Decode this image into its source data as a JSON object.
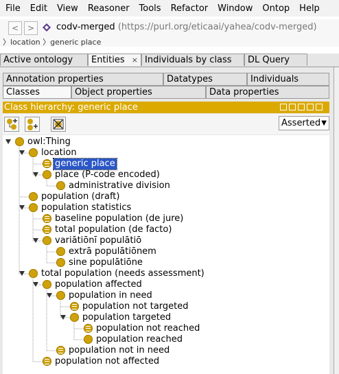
{
  "menu": [
    "File",
    "Edit",
    "View",
    "Reasoner",
    "Tools",
    "Refactor",
    "Window",
    "Ontop",
    "Help"
  ],
  "address": {
    "back_label": "<",
    "forward_label": ">",
    "ontology_name": "codv-merged",
    "ontology_url": "(https://purl.org/eticaai/yahea/codv-merged)",
    "breadcrumb": "〉location 〉generic place"
  },
  "main_tabs": [
    {
      "label": "Active ontology",
      "active": false
    },
    {
      "label": "Entities",
      "active": true
    },
    {
      "label": "Individuals by class",
      "active": false
    },
    {
      "label": "DL Query",
      "active": false
    }
  ],
  "close_glyph": "×",
  "entity_tabs_row1": [
    "Annotation properties",
    "Datatypes",
    "Individuals"
  ],
  "entity_tabs_row2": [
    "Classes",
    "Object properties",
    "Data properties"
  ],
  "hierarchy": {
    "title": "Class hierarchy: generic place",
    "view_mode": "Asserted",
    "nodes": [
      {
        "label": "owl:Thing",
        "depth": 0,
        "expanded": true,
        "leaf": false
      },
      {
        "label": "location",
        "depth": 1,
        "expanded": true,
        "leaf": false
      },
      {
        "label": "generic place",
        "depth": 2,
        "expanded": false,
        "leaf": true,
        "selected": true
      },
      {
        "label": "place (P-code encoded)",
        "depth": 2,
        "expanded": true,
        "leaf": false
      },
      {
        "label": "administrative division",
        "depth": 3,
        "expanded": false,
        "leaf": false
      },
      {
        "label": "population (draft)",
        "depth": 1,
        "expanded": false,
        "leaf": false
      },
      {
        "label": "population statistics",
        "depth": 1,
        "expanded": true,
        "leaf": false
      },
      {
        "label": "baseline population (de jure)",
        "depth": 2,
        "expanded": false,
        "leaf": true
      },
      {
        "label": "total population (de facto)",
        "depth": 2,
        "expanded": false,
        "leaf": true
      },
      {
        "label": "variātiōnī populātiō",
        "depth": 2,
        "expanded": true,
        "leaf": false
      },
      {
        "label": "extrā populātiōnem",
        "depth": 3,
        "expanded": false,
        "leaf": false
      },
      {
        "label": "sine populātiōne",
        "depth": 3,
        "expanded": false,
        "leaf": false
      },
      {
        "label": "total population (needs assessment)",
        "depth": 1,
        "expanded": true,
        "leaf": false
      },
      {
        "label": "population affected",
        "depth": 2,
        "expanded": true,
        "leaf": false
      },
      {
        "label": "population in need",
        "depth": 3,
        "expanded": true,
        "leaf": false
      },
      {
        "label": "population not targeted",
        "depth": 4,
        "expanded": false,
        "leaf": true
      },
      {
        "label": "population targeted",
        "depth": 4,
        "expanded": true,
        "leaf": false
      },
      {
        "label": "population not reached",
        "depth": 5,
        "expanded": false,
        "leaf": true
      },
      {
        "label": "population reached",
        "depth": 5,
        "expanded": false,
        "leaf": false
      },
      {
        "label": "population not in need",
        "depth": 3,
        "expanded": false,
        "leaf": true
      },
      {
        "label": "population not affected",
        "depth": 2,
        "expanded": false,
        "leaf": true
      }
    ]
  },
  "colors": {
    "accent": "#dba900",
    "class_dot": "#cfa20b",
    "selection": "#2a56c6"
  }
}
